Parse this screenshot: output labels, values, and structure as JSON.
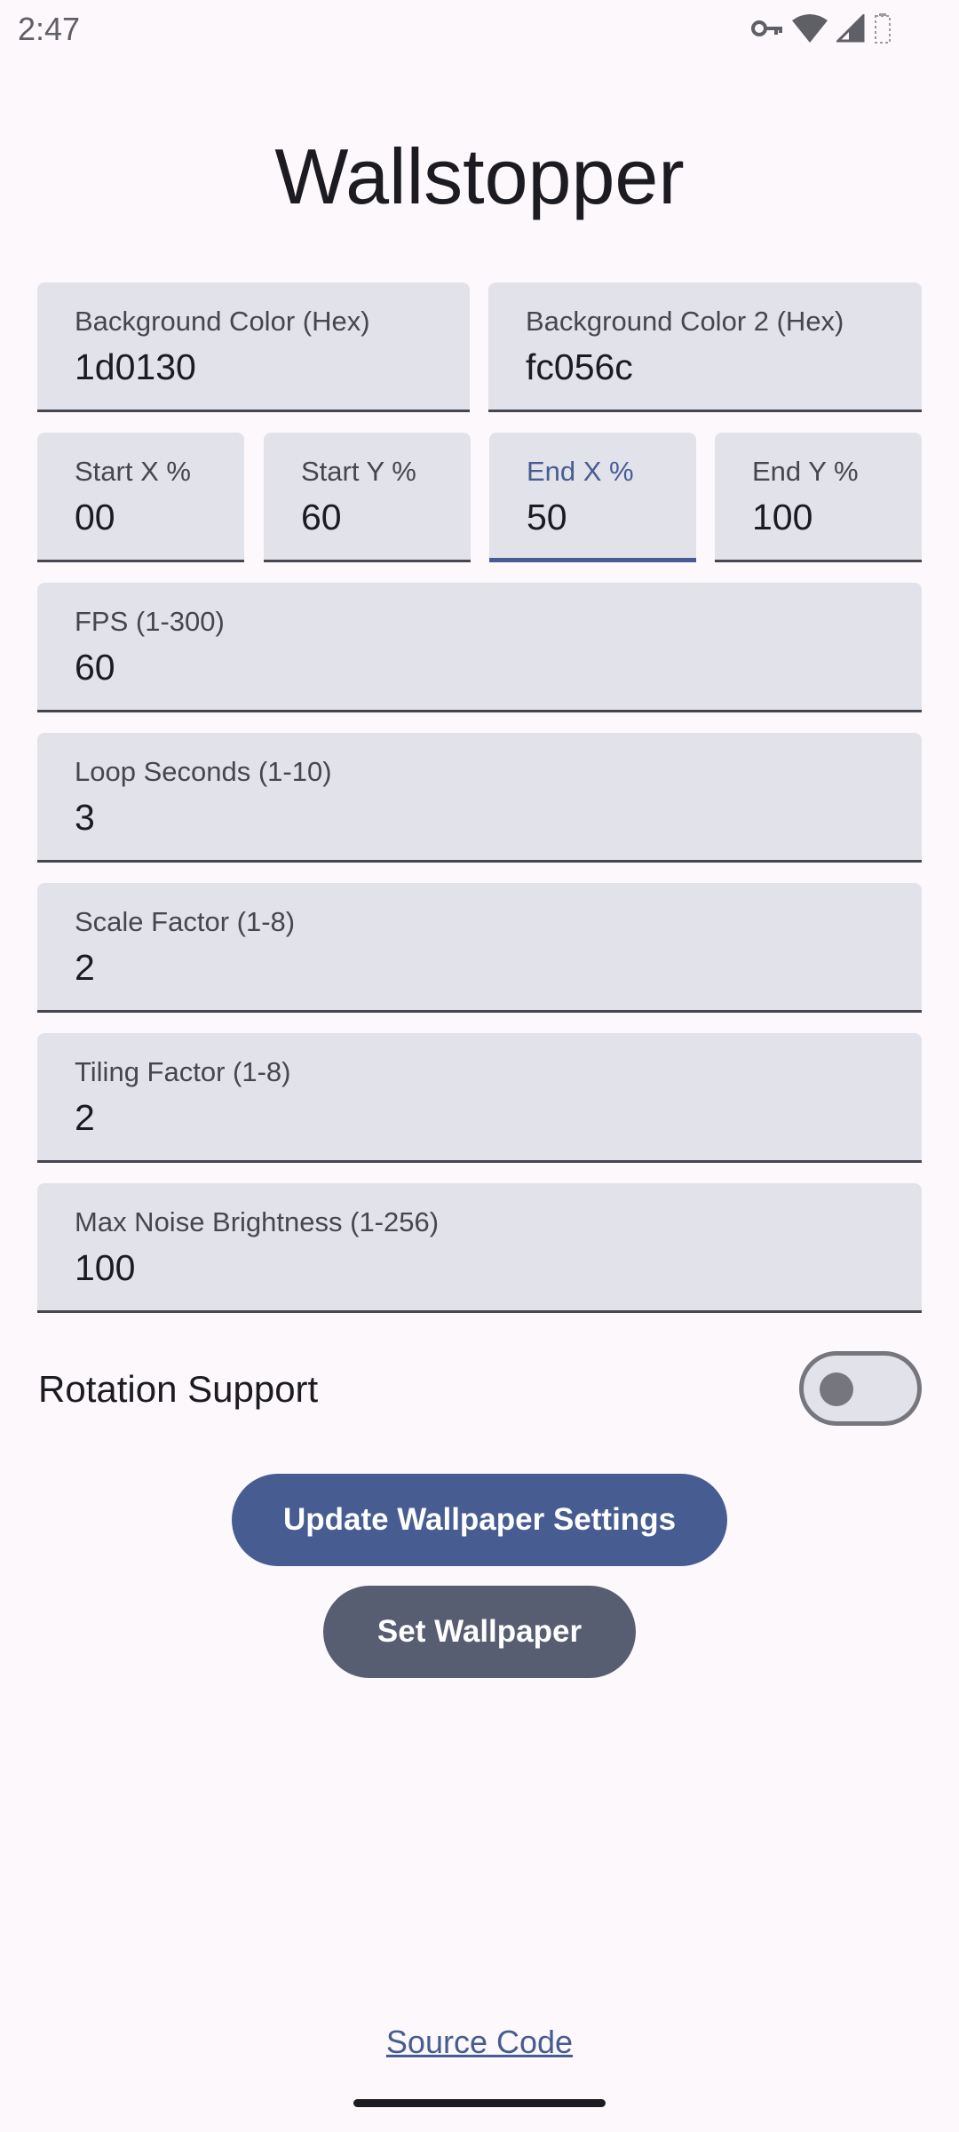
{
  "status_bar": {
    "time": "2:47",
    "icons": [
      "vpn-key-icon",
      "wifi-icon",
      "cell-signal-icon",
      "battery-icon"
    ]
  },
  "app": {
    "title": "Wallstopper"
  },
  "fields": {
    "bg_color": {
      "label": "Background Color (Hex)",
      "value": "1d0130"
    },
    "bg_color_2": {
      "label": "Background Color 2 (Hex)",
      "value": "fc056c"
    },
    "start_x": {
      "label": "Start X %",
      "value": "00"
    },
    "start_y": {
      "label": "Start Y %",
      "value": "60"
    },
    "end_x": {
      "label": "End X %",
      "value": "50",
      "focused": true
    },
    "end_y": {
      "label": "End Y %",
      "value": "100"
    },
    "fps": {
      "label": "FPS (1-300)",
      "value": "60"
    },
    "loop_seconds": {
      "label": "Loop Seconds (1-10)",
      "value": "3"
    },
    "scale_factor": {
      "label": "Scale Factor (1-8)",
      "value": "2"
    },
    "tiling_factor": {
      "label": "Tiling Factor (1-8)",
      "value": "2"
    },
    "max_noise": {
      "label": "Max Noise Brightness (1-256)",
      "value": "100"
    }
  },
  "rotation": {
    "label": "Rotation Support",
    "enabled": false
  },
  "buttons": {
    "update": "Update Wallpaper Settings",
    "set": "Set Wallpaper"
  },
  "footer": {
    "source_link": "Source Code"
  },
  "colors": {
    "primary": "#475d92",
    "secondary": "#575e71",
    "field_bg": "#e2e2ea",
    "background": "#fcf8fb"
  }
}
